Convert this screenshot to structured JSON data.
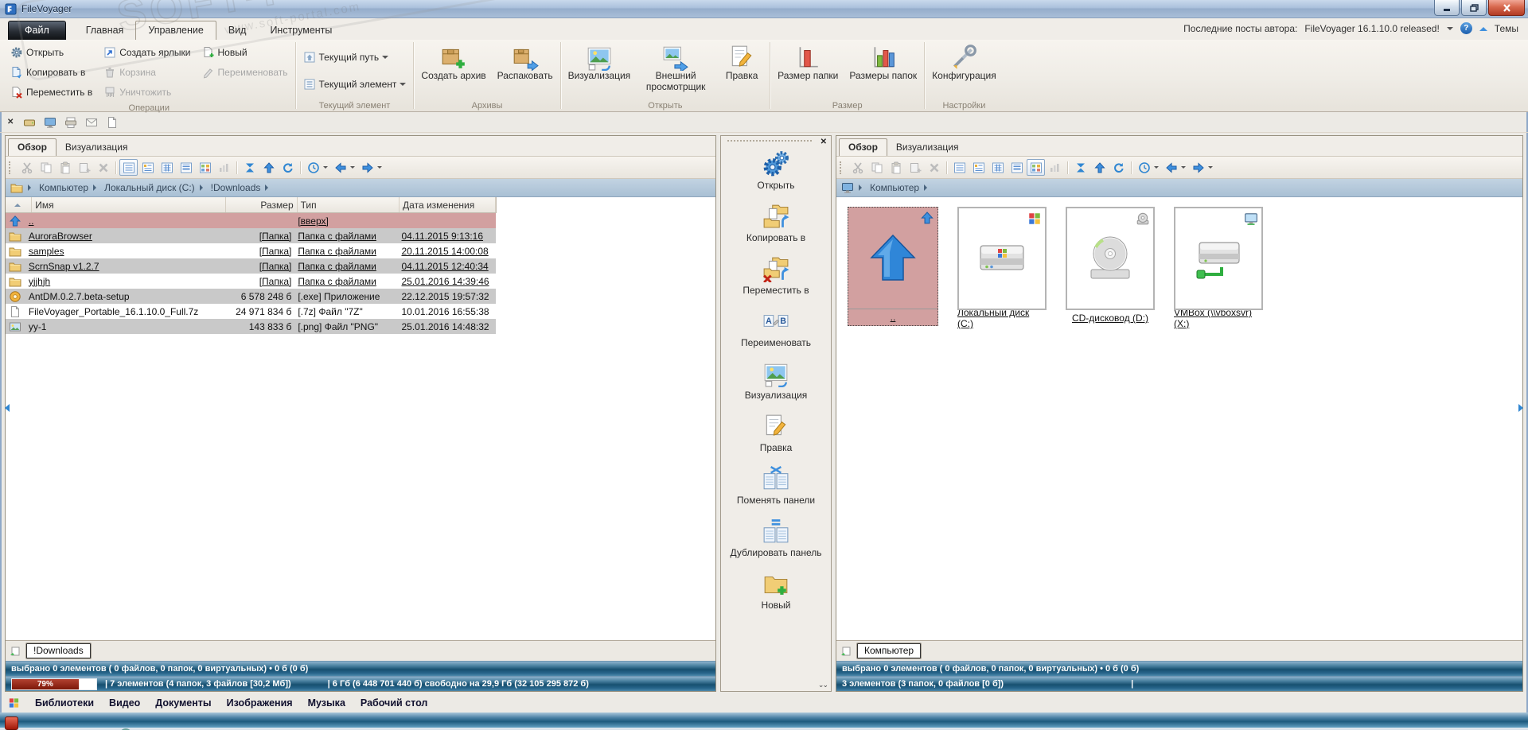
{
  "window": {
    "title": "FileVoyager"
  },
  "notif": {
    "label": "Последние посты автора:",
    "link": "FileVoyager 16.1.10.0 released!",
    "help": "?",
    "themes": "Темы"
  },
  "watermark": {
    "stamp": "SOFT-PORTAL",
    "url": "www.soft-portal.com"
  },
  "ribbon": {
    "tabs": [
      {
        "key": "file",
        "label": "Файл"
      },
      {
        "key": "home",
        "label": "Главная"
      },
      {
        "key": "manage",
        "label": "Управление",
        "active": true
      },
      {
        "key": "view",
        "label": "Вид"
      },
      {
        "key": "tools",
        "label": "Инструменты"
      }
    ],
    "groups": [
      {
        "label": "Операции",
        "type": "small-cols",
        "cols": [
          [
            {
              "label": "Открыть",
              "icon": "gear-s"
            },
            {
              "label": "Копировать в",
              "icon": "copy-doc"
            },
            {
              "label": "Переместить в",
              "icon": "move-doc"
            }
          ],
          [
            {
              "label": "Создать ярлыки",
              "icon": "shortcut"
            },
            {
              "label": "Корзина",
              "icon": "trash",
              "disabled": true
            },
            {
              "label": "Уничтожить",
              "icon": "shred",
              "disabled": true
            }
          ],
          [
            {
              "label": "Новый",
              "icon": "newdoc-plus"
            },
            {
              "label": "Переименовать",
              "icon": "rename-gray",
              "disabled": true
            }
          ]
        ]
      },
      {
        "label": "Текущий элемент",
        "type": "small-rows",
        "buttons": [
          {
            "label": "Текущий путь",
            "icon": "cur-path",
            "caret": true
          },
          {
            "label": "Текущий элемент",
            "icon": "cur-item",
            "caret": true
          }
        ]
      },
      {
        "label": "Архивы",
        "type": "big",
        "buttons": [
          {
            "label": "Создать архив",
            "icon": "archive-plus"
          },
          {
            "label": "Распаковать",
            "icon": "unpack"
          }
        ]
      },
      {
        "label": "Открыть",
        "type": "big",
        "buttons": [
          {
            "label": "Визуализация",
            "icon": "visual"
          },
          {
            "label": "Внешний просмотрщик",
            "icon": "ext-view"
          },
          {
            "label": "Правка",
            "icon": "edit-doc"
          }
        ]
      },
      {
        "label": "Размер",
        "type": "big",
        "buttons": [
          {
            "label": "Размер папки",
            "icon": "size-bar"
          },
          {
            "label": "Размеры папок",
            "icon": "sizes-bars"
          }
        ]
      },
      {
        "label": "Настройки",
        "type": "big",
        "buttons": [
          {
            "label": "Конфигурация",
            "icon": "config"
          }
        ]
      }
    ]
  },
  "quickbar": {
    "icons": [
      "qdrive",
      "qdisplay",
      "qprinter",
      "qmail",
      "qdoc"
    ]
  },
  "left_panel": {
    "tabs": [
      {
        "label": "Обзор",
        "active": true
      },
      {
        "label": "Визуализация"
      }
    ],
    "selected_view": 0,
    "breadcrumb": {
      "icon": "folder",
      "items": [
        "Компьютер",
        "Локальный диск (C:)",
        "!Downloads"
      ]
    },
    "view": "table",
    "columns": [
      "Имя",
      "Размер",
      "Тип",
      "Дата изменения"
    ],
    "rows": [
      {
        "icon": "up-arrow",
        "name": "..",
        "size": "",
        "type": "[вверх]",
        "date": "",
        "selected": true,
        "underline": true
      },
      {
        "icon": "folder",
        "name": "AuroraBrowser",
        "size": "[Папка]",
        "type": "Папка с файлами",
        "date": "04.11.2015 9:13:16",
        "underline": true
      },
      {
        "icon": "folder",
        "name": "samples",
        "size": "[Папка]",
        "type": "Папка с файлами",
        "date": "20.11.2015 14:00:08",
        "underline": true
      },
      {
        "icon": "folder",
        "name": "ScrnSnap v1.2.7",
        "size": "[Папка]",
        "type": "Папка с файлами",
        "date": "04.11.2015 12:40:34",
        "underline": true
      },
      {
        "icon": "folder",
        "name": "yjjhjh",
        "size": "[Папка]",
        "type": "Папка с файлами",
        "date": "25.01.2016 14:39:46",
        "underline": true
      },
      {
        "icon": "exe",
        "name": "AntDM.0.2.7.beta-setup",
        "size": "6 578 248 б",
        "type": "[.exe]  Приложение",
        "date": "22.12.2015 19:57:32",
        "underline": false
      },
      {
        "icon": "doc7z",
        "name": "FileVoyager_Portable_16.1.10.0_Full.7z",
        "size": "24 971 834 б",
        "type": "[.7z]  Файл \"7Z\"",
        "date": "10.01.2016 16:55:38",
        "underline": false
      },
      {
        "icon": "img",
        "name": "yy-1",
        "size": "143 833 б",
        "type": "[.png]  Файл \"PNG\"",
        "date": "25.01.2016 14:48:32",
        "underline": false
      }
    ],
    "bottom_tab": "!Downloads",
    "status_selected": "выбрано 0 элементов ( 0 файлов, 0 папок, 0 виртуальных) • 0 б (0 б)",
    "status_info": {
      "progress": "79%",
      "items": "| 7 элементов (4 папок, 3 файлов [30,2 Мб])",
      "free": "| 6 Гб (6 448 701 440 б) свободно на 29,9 Гб (32 105 295 872 б)"
    }
  },
  "middle_toolbar": {
    "items": [
      {
        "icon": "gears-blue",
        "label": "Открыть"
      },
      {
        "icon": "copy-to",
        "label": "Копировать в"
      },
      {
        "icon": "move-to",
        "label": "Переместить в"
      },
      {
        "icon": "rename-ab",
        "label": "Переименовать"
      },
      {
        "icon": "visual",
        "label": "Визуализация"
      },
      {
        "icon": "edit-doc",
        "label": "Правка"
      },
      {
        "icon": "swap-panels",
        "label": "Поменять панели"
      },
      {
        "icon": "dup-panels",
        "label": "Дублировать панель"
      },
      {
        "icon": "new-folder",
        "label": "Новый"
      }
    ]
  },
  "right_panel": {
    "tabs": [
      {
        "label": "Обзор",
        "active": true
      },
      {
        "label": "Визуализация"
      }
    ],
    "selected_view": 4,
    "breadcrumb": {
      "icon": "computer",
      "items": [
        "Компьютер"
      ]
    },
    "view": "tiles",
    "tiles": [
      {
        "icon": "big-up",
        "label": "..",
        "selected": true,
        "badge": "badge-up"
      },
      {
        "icon": "hdd",
        "label": "Локальный диск (C:)",
        "badge": "badge-win"
      },
      {
        "icon": "cd",
        "label": "CD-дисковод (D:)",
        "badge": "badge-disc"
      },
      {
        "icon": "net",
        "label": "VMBox (\\\\vboxsvr) (X:)",
        "badge": "badge-monitor"
      }
    ],
    "bottom_tab": "Компьютер",
    "status_selected": "выбрано 0 элементов ( 0 файлов, 0 папок, 0 виртуальных) • 0 б (0 б)",
    "status_info": {
      "items": "3 элементов (3 папок, 0 файлов [0 б])",
      "divider": "|"
    }
  },
  "footer": {
    "links": [
      "Библиотеки",
      "Видео",
      "Документы",
      "Изображения",
      "Музыка",
      "Рабочий стол"
    ]
  }
}
